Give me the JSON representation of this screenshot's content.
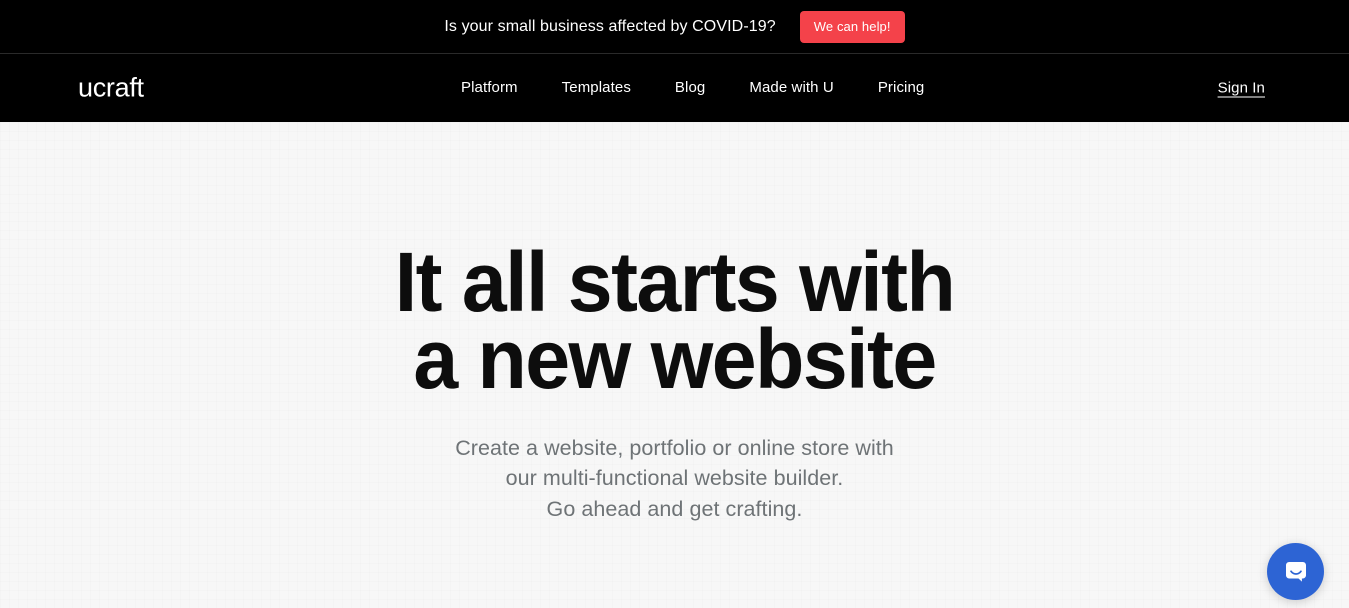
{
  "banner": {
    "text": "Is your small business affected by COVID-19?",
    "cta_label": "We can help!",
    "background_color": "#000000",
    "cta_color": "#f4424a",
    "text_color": "#ffffff"
  },
  "navbar": {
    "logo_text": "ucraft",
    "background_color": "#000000",
    "links": [
      {
        "label": "Platform"
      },
      {
        "label": "Templates"
      },
      {
        "label": "Blog"
      },
      {
        "label": "Made with U"
      },
      {
        "label": "Pricing"
      }
    ],
    "signin_label": "Sign In"
  },
  "hero": {
    "background_color": "#f7f7f7",
    "title_color": "#0d0d0d",
    "subtitle_color": "#6e7376",
    "title_lines": [
      "It all starts with",
      "a new website"
    ],
    "subtitle_lines": [
      "Create a website, portfolio or online store with",
      "our multi-functional website builder.",
      "Go ahead and get crafting."
    ]
  },
  "chat_widget": {
    "icon": "chat-bubble-smile-icon",
    "color": "#2d64d4"
  }
}
